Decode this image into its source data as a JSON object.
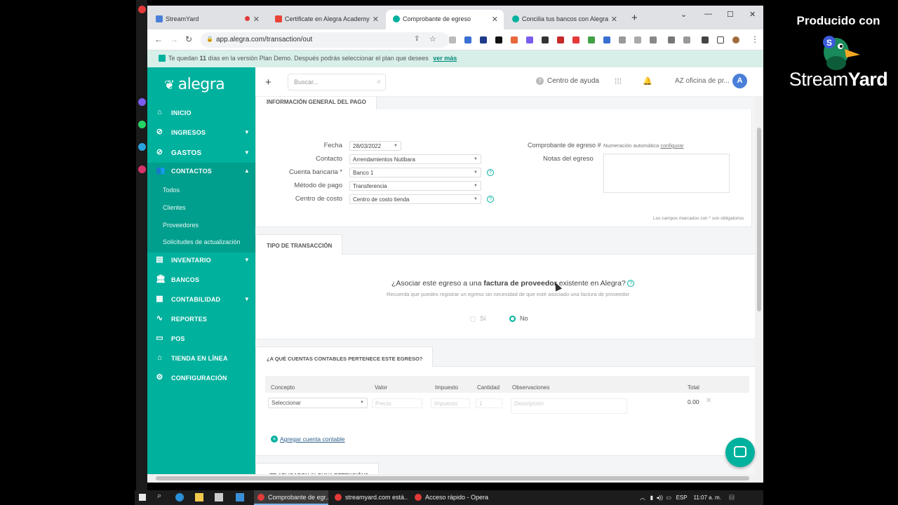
{
  "stream": {
    "producido": "Producido con",
    "brand_a": "Stream",
    "brand_b": "Yard"
  },
  "browser": {
    "tabs": [
      {
        "title": "StreamYard",
        "color": "#4a7fd9"
      },
      {
        "title": "Certificate en Alegra Academy",
        "color": "#ea4335"
      },
      {
        "title": "Comprobante de egreso",
        "color": "#00b19d"
      },
      {
        "title": "Concilia tus bancos con Alegra",
        "color": "#00b19d"
      }
    ],
    "url": "app.alegra.com/transaction/out"
  },
  "demo_bar": {
    "text_pre": "Te quedan ",
    "days": "11",
    "text_post": " días en la versión Plan Demo. Después podrás seleccionar el plan que desees",
    "link": "ver más"
  },
  "sidebar": {
    "logo": "alegra",
    "items": [
      {
        "label": "INICIO",
        "icon": "home-icon",
        "caret": false
      },
      {
        "label": "INGRESOS",
        "icon": "income-icon",
        "caret": true
      },
      {
        "label": "GASTOS",
        "icon": "expense-icon",
        "caret": true
      },
      {
        "label": "CONTACTOS",
        "icon": "contacts-icon",
        "caret": true
      },
      {
        "label": "INVENTARIO",
        "icon": "inventory-icon",
        "caret": true
      },
      {
        "label": "BANCOS",
        "icon": "bank-icon",
        "caret": false
      },
      {
        "label": "CONTABILIDAD",
        "icon": "accounting-icon",
        "caret": true
      },
      {
        "label": "REPORTES",
        "icon": "reports-icon",
        "caret": false
      },
      {
        "label": "POS",
        "icon": "pos-icon",
        "caret": false
      },
      {
        "label": "TIENDA EN LÍNEA",
        "icon": "store-icon",
        "caret": false
      },
      {
        "label": "CONFIGURACIÓN",
        "icon": "gear-icon",
        "caret": false
      }
    ],
    "contacts_sub": [
      "Todos",
      "Clientes",
      "Proveedores",
      "Solicitudes de actualización"
    ]
  },
  "header": {
    "search_placeholder": "Buscar...",
    "help": "Centro de ayuda",
    "company": "AZ oficina de pr...",
    "avatar": "A"
  },
  "general": {
    "section_title": "INFORMACIÓN GENERAL DEL PAGO",
    "fields": [
      {
        "label": "Fecha",
        "value": "28/03/2022"
      },
      {
        "label": "Contacto",
        "value": "Arrendamientos Nutibara"
      },
      {
        "label": "Cuenta bancaria *",
        "value": "Banco 1"
      },
      {
        "label": "Método de pago",
        "value": "Transferencia"
      },
      {
        "label": "Centro de costo",
        "value": "Centro de costo tienda"
      }
    ],
    "voucher_label": "Comprobante de egreso #",
    "voucher_value": "Numeración automática",
    "voucher_link": "configurar",
    "notes_label": "Notas del egreso",
    "required_note": "Los campos marcados con * son obligatorios"
  },
  "transaction": {
    "section_title": "TIPO DE TRANSACCIÓN",
    "question_pre": "¿Asociar este egreso a una ",
    "question_bold": "factura de proveedor",
    "question_post": " existente en Alegra?",
    "hint": "Recuerda que puedes registrar un egreso sin necesidad de que esté asociado una factura de proveedor",
    "option_yes": "Sí",
    "option_no": "No",
    "selected": "No"
  },
  "accounts": {
    "section_title": "¿A QUÉ CUENTAS CONTABLES PERTENECE ESTE EGRESO?",
    "columns": [
      "Concepto",
      "Valor",
      "Impuesto",
      "Cantidad",
      "Observaciones",
      "Total"
    ],
    "row": {
      "concept": "Seleccionar",
      "value_ph": "Precio",
      "tax_ph": "Impuesto",
      "qty": "1",
      "obs_ph": "Descripción",
      "total": "0.00"
    },
    "add_link": "Agregar cuenta contable"
  },
  "retention": {
    "section_title": "¿TE APLICARON ALGUNA RETENCIÓN?"
  },
  "taskbar": {
    "ghost": "Comprobante de egr...   Acceso rápido - Opera   streamyard.com está...",
    "apps": [
      {
        "label": "Comprobante de egr...",
        "color": "#e23a3a"
      },
      {
        "label": "streamyard.com está...",
        "color": "#e23a3a"
      },
      {
        "label": "Acceso rápido - Opera",
        "color": "#e23a3a"
      }
    ],
    "lang": "ESP",
    "time": "11:07 a. m."
  }
}
